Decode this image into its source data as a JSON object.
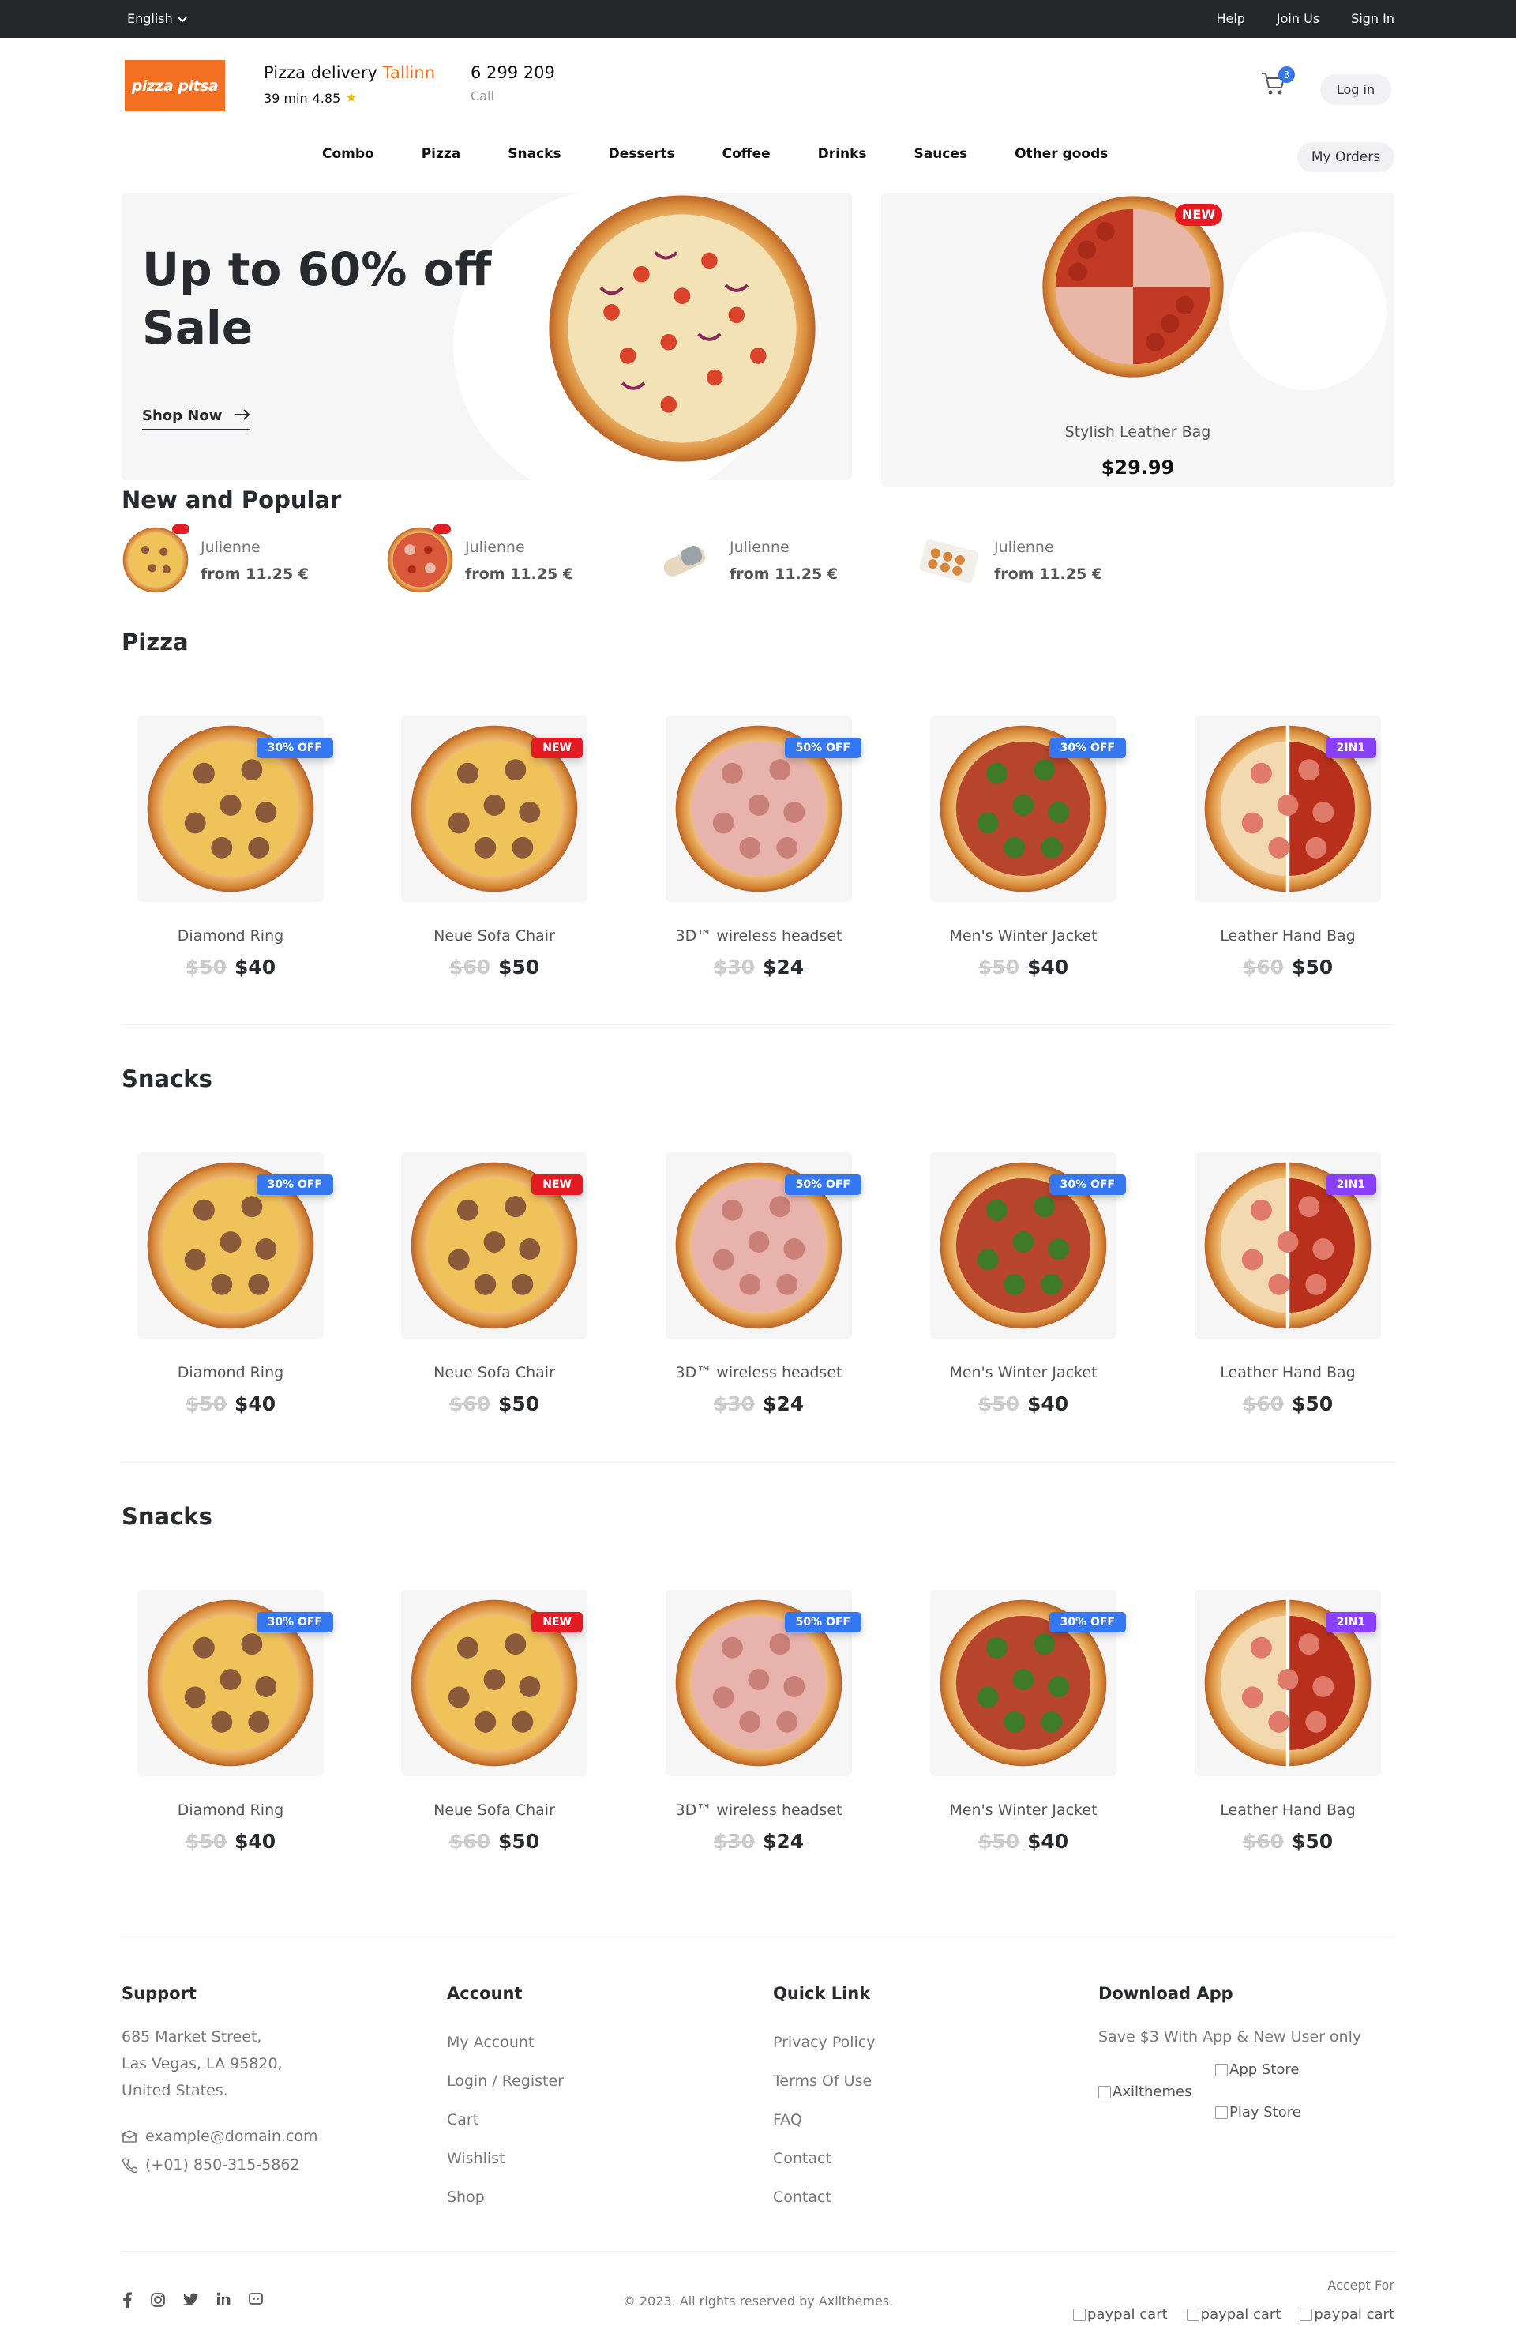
{
  "topbar": {
    "language": "English",
    "links": [
      "Help",
      "Join Us",
      "Sign In"
    ]
  },
  "header": {
    "logo_text": "pizza pitsa",
    "delivery_label": "Pizza delivery",
    "city": "Tallinn",
    "delivery_time": "39 min",
    "rating": "4.85",
    "phone": "6 299 209",
    "phone_label": "Call",
    "cart_count": "3",
    "login_label": "Log in"
  },
  "nav": {
    "items": [
      "Combo",
      "Pizza",
      "Snacks",
      "Desserts",
      "Coffee",
      "Drinks",
      "Sauces",
      "Other goods"
    ],
    "orders_label": "My Orders"
  },
  "hero": {
    "main": {
      "title_line1": "Up to 60% off",
      "title_line2": "Sale",
      "cta": "Shop Now"
    },
    "side": {
      "badge": "NEW",
      "name": "Stylish Leather Bag",
      "price": "$29.99"
    }
  },
  "popular": {
    "title": "New and Popular",
    "items": [
      {
        "name": "Julienne",
        "price": "from 11.25 €"
      },
      {
        "name": "Julienne",
        "price": "from 11.25 €"
      },
      {
        "name": "Julienne",
        "price": "from 11.25 €"
      },
      {
        "name": "Julienne",
        "price": "from 11.25 €"
      }
    ]
  },
  "sections": [
    {
      "title": "Pizza"
    },
    {
      "title": "Snacks"
    },
    {
      "title": "Snacks"
    }
  ],
  "products": [
    {
      "name": "Diamond Ring",
      "old_price": "$50",
      "price": "$40",
      "badge": "30% OFF"
    },
    {
      "name": "Neue Sofa Chair",
      "old_price": "$60",
      "price": "$50",
      "badge": "NEW"
    },
    {
      "name": "3D™ wireless headset",
      "old_price": "$30",
      "price": "$24",
      "badge": "50% OFF"
    },
    {
      "name": "Men's Winter Jacket",
      "old_price": "$50",
      "price": "$40",
      "badge": "30% OFF"
    },
    {
      "name": "Leather Hand Bag",
      "old_price": "$60",
      "price": "$50",
      "badge": "2IN1"
    }
  ],
  "colors": {
    "accent": "#f36f21",
    "blue": "#3577f0",
    "red": "#e41b23",
    "purple": "#8a3ffc"
  },
  "footer": {
    "support": {
      "title": "Support",
      "address_1": "685 Market Street,",
      "address_2": "Las Vegas, LA 95820,",
      "address_3": "United States.",
      "email": "example@domain.com",
      "phone": "(+01) 850-315-5862"
    },
    "account": {
      "title": "Account",
      "links": [
        "My Account",
        "Login / Register",
        "Cart",
        "Wishlist",
        "Shop"
      ]
    },
    "quick": {
      "title": "Quick Link",
      "links": [
        "Privacy Policy",
        "Terms Of Use",
        "FAQ",
        "Contact",
        "Contact"
      ]
    },
    "app": {
      "title": "Download App",
      "subtitle": "Save $3 With App & New User only",
      "qr_alt": "Axilthemes",
      "app_store": "App Store",
      "play_store": "Play Store"
    },
    "copyright": "© 2023. All rights reserved by Axilthemes.",
    "accept_label": "Accept For",
    "payment_alts": [
      "paypal cart",
      "paypal cart",
      "paypal cart"
    ]
  }
}
